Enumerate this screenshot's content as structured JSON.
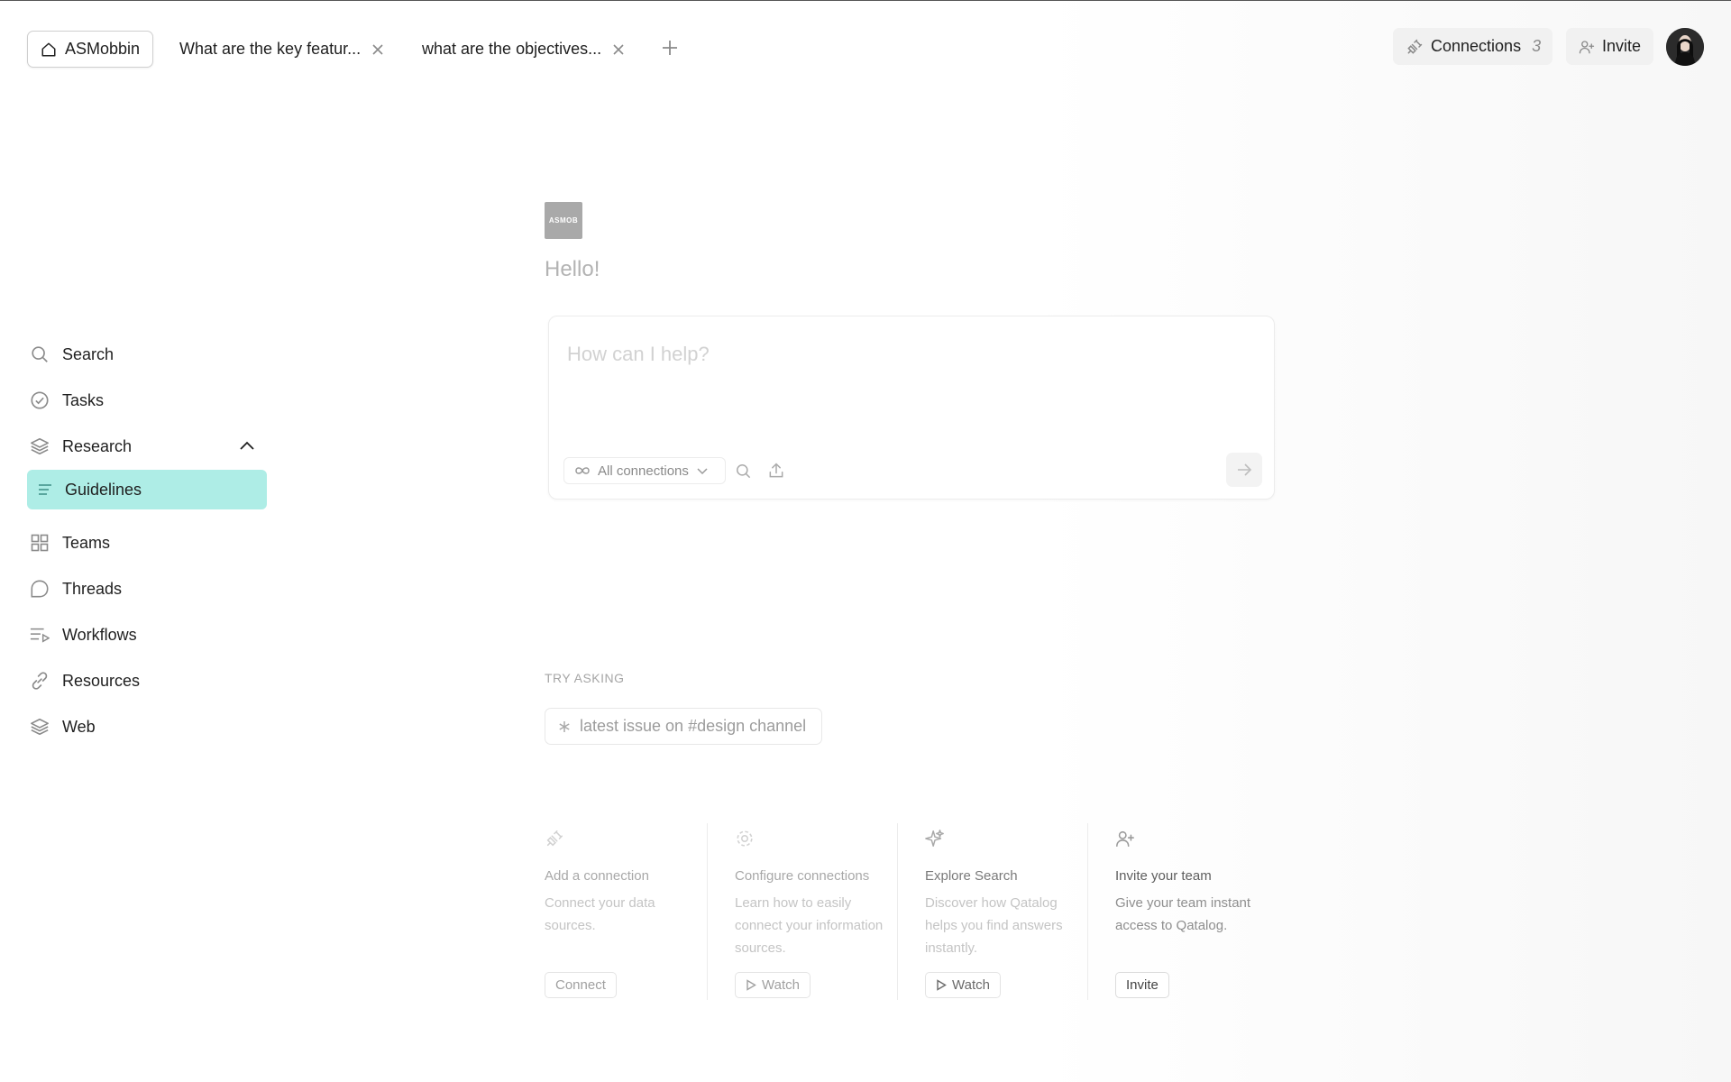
{
  "tabs": {
    "home": {
      "label": "ASMobbin",
      "icon": "home-icon"
    },
    "open": [
      {
        "label": "What are the key featur...",
        "close_icon": "close-icon"
      },
      {
        "label": "what are the objectives...",
        "close_icon": "close-icon"
      }
    ],
    "new_tab_icon": "plus-icon"
  },
  "header": {
    "connections": {
      "label": "Connections",
      "count": "3",
      "icon": "plug-icon"
    },
    "invite": {
      "label": "Invite",
      "icon": "user-plus-icon"
    },
    "avatar_icon": "avatar"
  },
  "sidebar": {
    "items": [
      {
        "label": "Search",
        "icon": "search-icon"
      },
      {
        "label": "Tasks",
        "icon": "check-circle-icon"
      },
      {
        "label": "Research",
        "icon": "layers-icon",
        "expanded": true
      },
      {
        "label": "Guidelines",
        "icon": "lines-icon",
        "active": true
      },
      {
        "label": "Teams",
        "icon": "grid-icon"
      },
      {
        "label": "Threads",
        "icon": "chat-bubble-icon"
      },
      {
        "label": "Workflows",
        "icon": "list-play-icon"
      },
      {
        "label": "Resources",
        "icon": "link-icon"
      },
      {
        "label": "Web",
        "icon": "layers-icon"
      }
    ],
    "active_color": "#aeede6"
  },
  "main": {
    "logo_text": "ASMOB",
    "greeting": "Hello!",
    "prompt": {
      "placeholder": "How can I help?",
      "value": "",
      "connections_select": "All connections",
      "search_icon": "search-icon",
      "upload_icon": "upload-icon",
      "send_icon": "arrow-right-icon"
    },
    "try_asking": {
      "label": "TRY ASKING",
      "suggestions": [
        "latest issue on #design channel"
      ]
    },
    "cards": [
      {
        "title": "Add a connection",
        "desc": "Connect your data sources.",
        "button": "Connect",
        "icon": "plug-icon"
      },
      {
        "title": "Configure connections",
        "desc": "Learn how to easily connect your information sources.",
        "button": "Watch",
        "icon": "gear-icon"
      },
      {
        "title": "Explore Search",
        "desc": "Discover how Qatalog helps you find answers instantly.",
        "button": "Watch",
        "icon": "sparkle-icon"
      },
      {
        "title": "Invite your team",
        "desc": "Give your team instant access to Qatalog.",
        "button": "Invite",
        "icon": "user-plus-icon"
      }
    ]
  }
}
